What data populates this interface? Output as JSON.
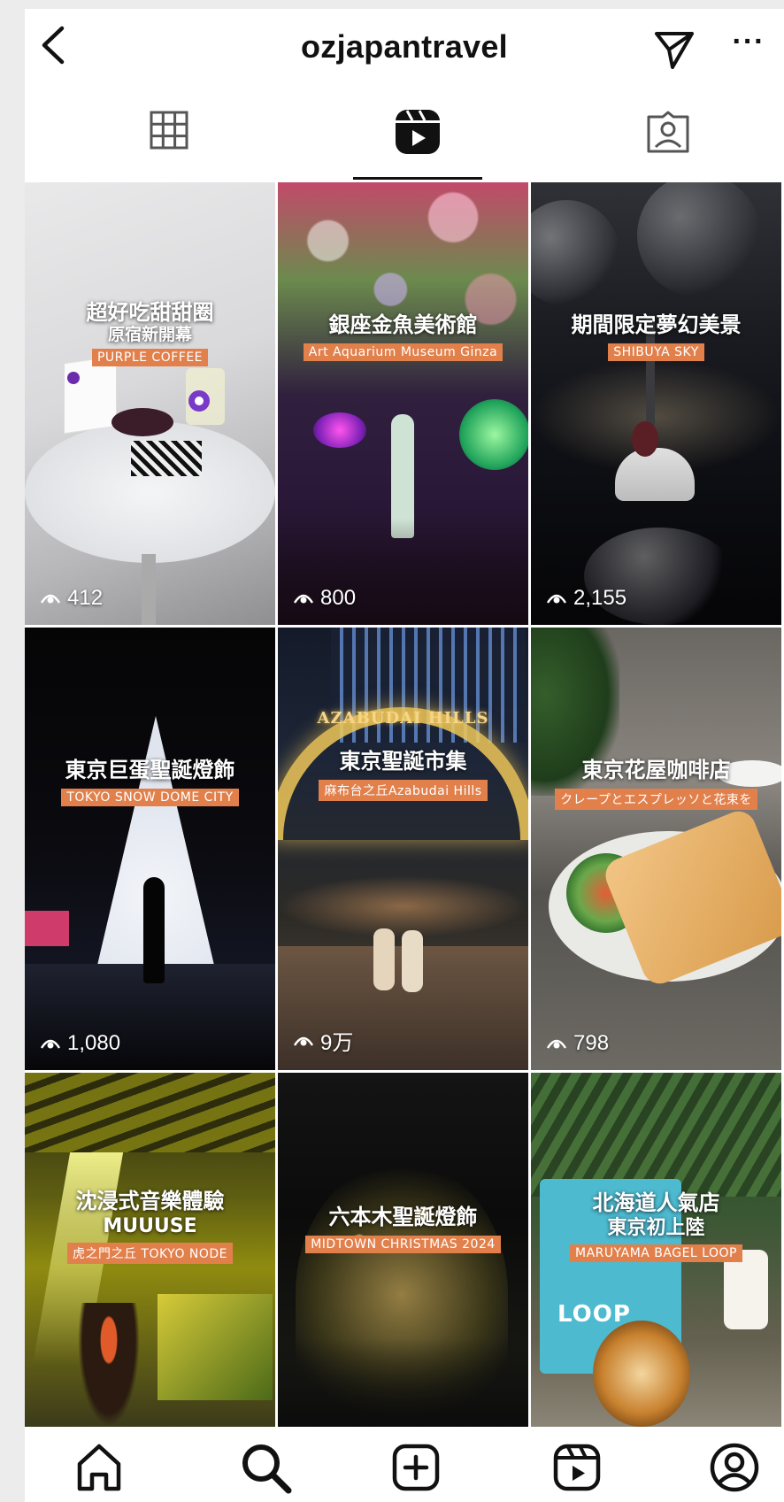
{
  "header": {
    "username": "ozjapantravel",
    "more_label": "···"
  },
  "tabs": [
    {
      "name": "grid",
      "icon": "grid-icon",
      "active": false
    },
    {
      "name": "reels",
      "icon": "reels-icon",
      "active": true
    },
    {
      "name": "tagged",
      "icon": "tagged-icon",
      "active": false
    }
  ],
  "reels": [
    {
      "title": "超好吃甜甜圈",
      "subtitle": "原宿新開幕",
      "tag": "PURPLE COFFEE",
      "views": "412"
    },
    {
      "title": "銀座金魚美術館",
      "subtitle": "",
      "tag": "Art Aquarium Museum Ginza",
      "views": "800"
    },
    {
      "title": "期間限定夢幻美景",
      "subtitle": "",
      "tag": "SHIBUYA SKY",
      "views": "2,155"
    },
    {
      "title": "東京巨蛋聖誕燈飾",
      "subtitle": "",
      "tag": "TOKYO SNOW DOME CITY",
      "views": "1,080"
    },
    {
      "title": "東京聖誕市集",
      "subtitle": "",
      "tag": "麻布台之丘Azabudai Hills",
      "views": "9万",
      "overlay_text": "AZABUDAI HILLS"
    },
    {
      "title": "東京花屋咖啡店",
      "subtitle": "",
      "tag": "クレープとエスプレッソと花束を",
      "views": "798"
    },
    {
      "title": "沈浸式音樂體驗",
      "subtitle": "MUUUSE",
      "tag": "虎之門之丘 TOKYO NODE",
      "views": ""
    },
    {
      "title": "六本木聖誕燈飾",
      "subtitle": "",
      "tag": "MIDTOWN CHRISTMAS 2024",
      "views": ""
    },
    {
      "title": "北海道人氣店",
      "subtitle": "東京初上陸",
      "tag": "MARUYAMA BAGEL LOOP",
      "views": "",
      "overlay_text": "LOOP"
    }
  ],
  "bottom_nav": [
    {
      "name": "home",
      "icon": "home-icon"
    },
    {
      "name": "search",
      "icon": "search-icon"
    },
    {
      "name": "create",
      "icon": "plus-square-icon"
    },
    {
      "name": "reels",
      "icon": "reels-icon"
    },
    {
      "name": "profile",
      "icon": "profile-icon"
    }
  ],
  "colors": {
    "tag_background": "#e2804c",
    "text_primary": "#111111",
    "background": "#ffffff"
  }
}
